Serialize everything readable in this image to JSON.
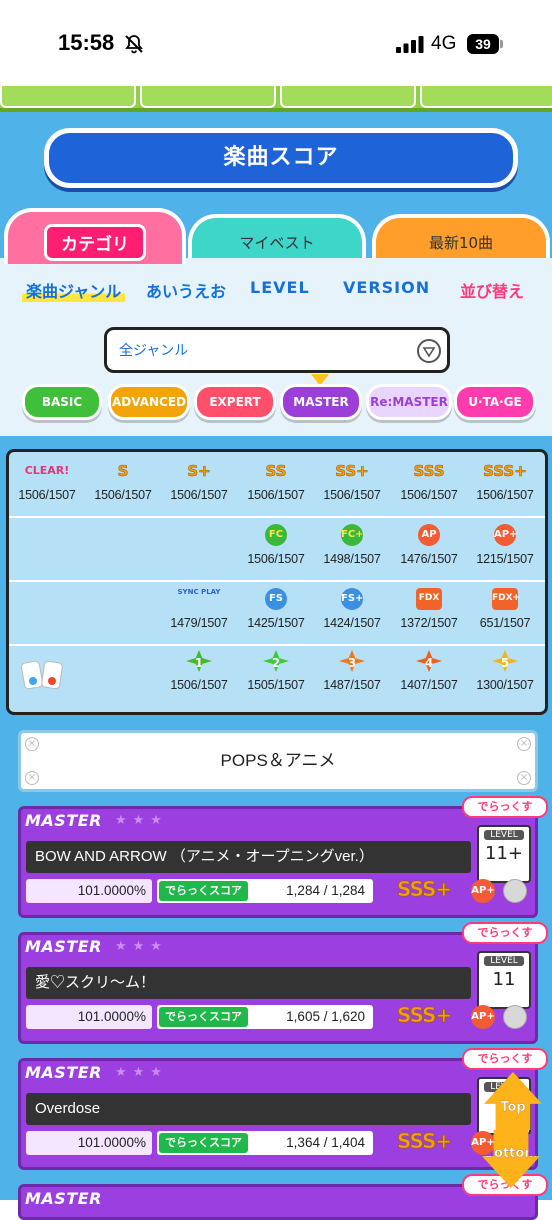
{
  "status_bar": {
    "time": "15:58",
    "network": "4G",
    "battery": "39"
  },
  "header": {
    "title": "楽曲スコア"
  },
  "tabs": [
    {
      "label": "カテゴリ"
    },
    {
      "label": "マイベスト"
    },
    {
      "label": "最新10曲"
    }
  ],
  "sort_links": [
    "楽曲ジャンル",
    "あいうえお",
    "LEVEL",
    "VERSION",
    "並び替え"
  ],
  "genre_select": {
    "value": "全ジャンル"
  },
  "difficulties": [
    "BASIC",
    "ADVANCED",
    "EXPERT",
    "MASTER",
    "Re:MASTER",
    "U·TA·GE"
  ],
  "stats": {
    "rank_row": [
      {
        "badge": "CLEAR!",
        "value": "1506/1507"
      },
      {
        "badge": "S",
        "value": "1506/1507"
      },
      {
        "badge": "S+",
        "value": "1506/1507"
      },
      {
        "badge": "SS",
        "value": "1506/1507"
      },
      {
        "badge": "SS+",
        "value": "1506/1507"
      },
      {
        "badge": "SSS",
        "value": "1506/1507"
      },
      {
        "badge": "SSS+",
        "value": "1506/1507"
      }
    ],
    "combo_row": [
      {
        "badge": "FC",
        "value": "1506/1507"
      },
      {
        "badge": "FC+",
        "value": "1498/1507"
      },
      {
        "badge": "AP",
        "value": "1476/1507"
      },
      {
        "badge": "AP+",
        "value": "1215/1507"
      }
    ],
    "sync_row": [
      {
        "badge": "SYNC PLAY",
        "value": "1479/1507"
      },
      {
        "badge": "FS",
        "value": "1425/1507"
      },
      {
        "badge": "FS+",
        "value": "1424/1507"
      },
      {
        "badge": "FDX",
        "value": "1372/1507"
      },
      {
        "badge": "FDX+",
        "value": "651/1507"
      }
    ],
    "star_row": [
      {
        "badge": "1",
        "value": "1506/1507"
      },
      {
        "badge": "2",
        "value": "1505/1507"
      },
      {
        "badge": "3",
        "value": "1487/1507"
      },
      {
        "badge": "4",
        "value": "1407/1507"
      },
      {
        "badge": "5",
        "value": "1300/1507"
      }
    ]
  },
  "genre_header": "POPS＆アニメ",
  "dx_tag": "でらっくす",
  "songs": [
    {
      "difficulty": "MASTER",
      "title": "BOW AND ARROW （アニメ・オープニングver.）",
      "level_label": "LEVEL",
      "level": "11+",
      "achievement": "101.0000%",
      "dx_label": "でらっくスコア",
      "dx_score": "1,284 / 1,284",
      "rank": "SSS+",
      "combo": "AP+"
    },
    {
      "difficulty": "MASTER",
      "title": "愛♡スクリ～ム！",
      "level_label": "LEVEL",
      "level": "11",
      "achievement": "101.0000%",
      "dx_label": "でらっくスコア",
      "dx_score": "1,605 / 1,620",
      "rank": "SSS+",
      "combo": "AP+"
    },
    {
      "difficulty": "MASTER",
      "title": "Overdose",
      "level_label": "LEVEL",
      "level": "",
      "achievement": "101.0000%",
      "dx_label": "でらっくスコア",
      "dx_score": "1,364 / 1,404",
      "rank": "SSS+",
      "combo": "AP+"
    },
    {
      "difficulty": "MASTER"
    }
  ],
  "scroll": {
    "top": "Top",
    "bottom": "Bottom"
  },
  "colors": {
    "main_blue": "#4fb2e8",
    "master_purple": "#9c3fe0",
    "nav_green": "#8fd144"
  }
}
